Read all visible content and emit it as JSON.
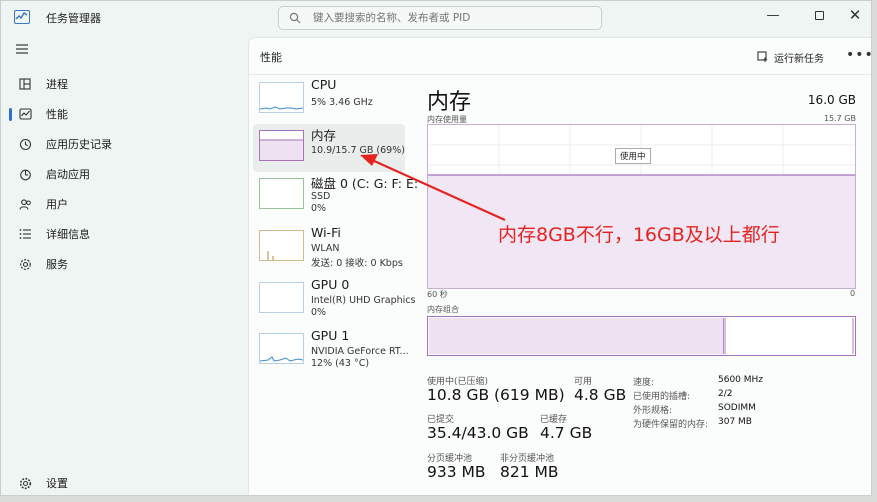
{
  "titlebar": {
    "title": "任务管理器",
    "search_placeholder": "键入要搜索的名称、发布者或 PID"
  },
  "sidebar": {
    "items": [
      {
        "label": "进程",
        "icon": "processes-icon"
      },
      {
        "label": "性能",
        "icon": "performance-icon",
        "active": true
      },
      {
        "label": "应用历史记录",
        "icon": "app-history-icon"
      },
      {
        "label": "启动应用",
        "icon": "startup-icon"
      },
      {
        "label": "用户",
        "icon": "users-icon"
      },
      {
        "label": "详细信息",
        "icon": "details-icon"
      },
      {
        "label": "服务",
        "icon": "services-icon"
      }
    ],
    "settings_label": "设置"
  },
  "header": {
    "title": "性能",
    "run_task": "运行新任务",
    "more": "•••"
  },
  "perf_list": [
    {
      "title": "CPU",
      "sub1": "5%  3.46 GHz"
    },
    {
      "title": "内存",
      "sub1": "10.9/15.7 GB (69%)"
    },
    {
      "title": "磁盘 0 (C: G: F: E:",
      "sub1": "SSD",
      "sub2": "0%"
    },
    {
      "title": "Wi-Fi",
      "sub1": "WLAN",
      "sub2": "发送: 0 接收: 0 Kbps"
    },
    {
      "title": "GPU 0",
      "sub1": "Intel(R) UHD Graphics",
      "sub2": "0%"
    },
    {
      "title": "GPU 1",
      "sub1": "NVIDIA GeForce RT...",
      "sub2": "12% (43 °C)"
    }
  ],
  "memory": {
    "title": "内存",
    "total": "16.0 GB",
    "usage_label": "内存使用量",
    "usage_max": "15.7 GB",
    "in_use_tip": "使用中",
    "axis_left": "60 秒",
    "axis_right": "0",
    "composition_label": "内存组合",
    "usage_fraction": 0.69,
    "stats": {
      "in_use_label": "使用中(已压缩)",
      "in_use_value": "10.8 GB (619 MB)",
      "available_label": "可用",
      "available_value": "4.8 GB",
      "committed_label": "已提交",
      "committed_value": "35.4/43.0 GB",
      "cached_label": "已缓存",
      "cached_value": "4.7 GB",
      "paged_label": "分页缓冲池",
      "paged_value": "933 MB",
      "nonpaged_label": "非分页缓冲池",
      "nonpaged_value": "821 MB"
    },
    "right": [
      {
        "label": "速度:",
        "value": "5600 MHz"
      },
      {
        "label": "已使用的插槽:",
        "value": "2/2"
      },
      {
        "label": "外形规格:",
        "value": "SODIMM"
      },
      {
        "label": "为硬件保留的内存:",
        "value": "307 MB"
      }
    ]
  },
  "annotation": {
    "text": "内存8GB不行，16GB及以上都行",
    "color": "#e52421"
  }
}
